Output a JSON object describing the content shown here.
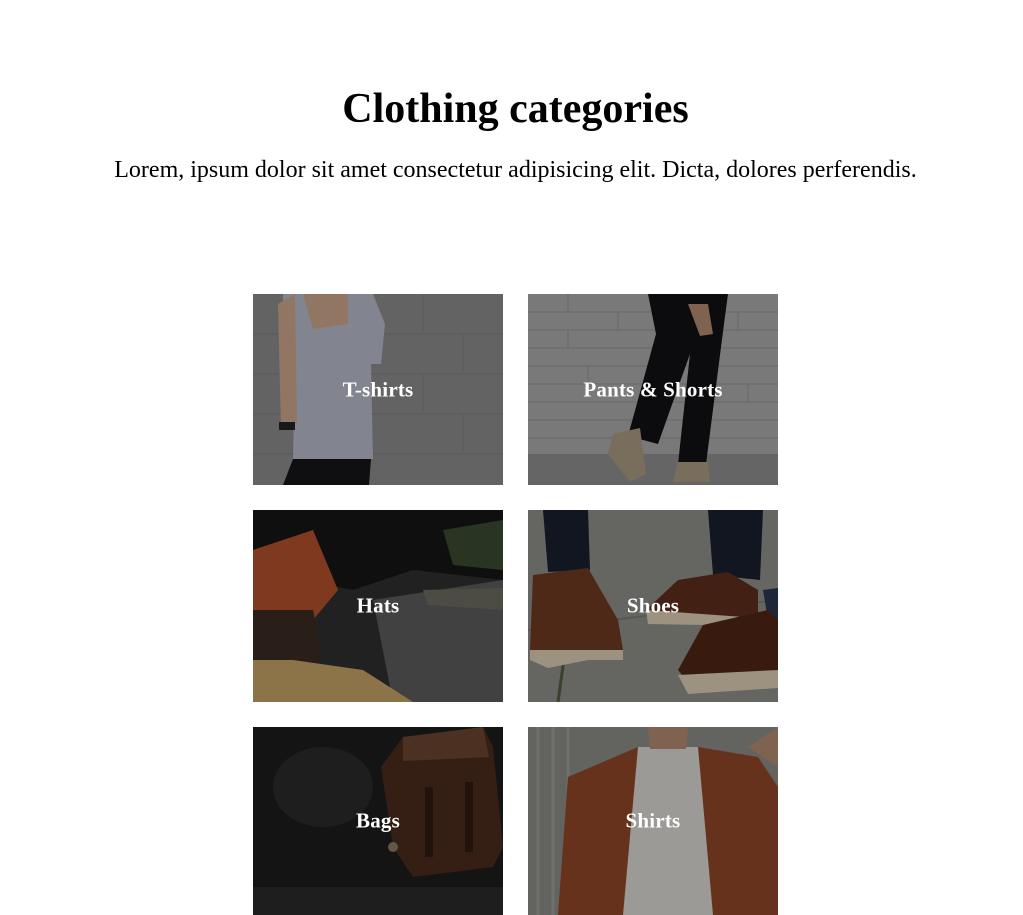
{
  "header": {
    "title": "Clothing categories",
    "subtitle": "Lorem, ipsum dolor sit amet consectetur adipisicing elit. Dicta, dolores perferendis."
  },
  "categories": [
    {
      "label": "T-shirts",
      "image": "man-in-grey-tshirt-photo"
    },
    {
      "label": "Pants & Shorts",
      "image": "black-pants-brick-wall-photo"
    },
    {
      "label": "Hats",
      "image": "man-in-red-beanie-photo"
    },
    {
      "label": "Shoes",
      "image": "brown-leather-boots-photo"
    },
    {
      "label": "Bags",
      "image": "leather-backpack-photo"
    },
    {
      "label": "Shirts",
      "image": "rust-button-shirt-photo"
    }
  ]
}
